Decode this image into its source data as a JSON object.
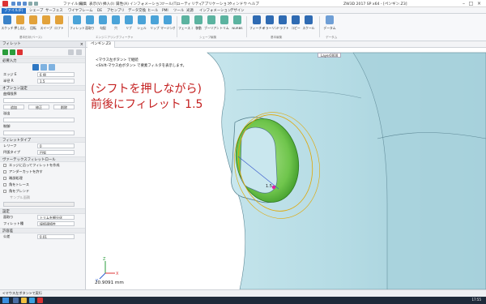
{
  "titlebar": {
    "menus": [
      "ファイル(F)",
      "編集",
      "表示(V)",
      "挿入(I)",
      "属性(A)",
      "インフォメーション",
      "ツール(T)",
      "ユーティリティ",
      "アプリケーション",
      "ウィンドウ",
      "ヘルプ"
    ],
    "title": "ZW3D 2017 SP x64 - [ペンギン.Z3]"
  },
  "tabs": [
    "ファイル(F)",
    "シェープ",
    "サーフェス",
    "ワイヤフレーム",
    "DE",
    "アセンブリ",
    "データ交換",
    "ヒール",
    "PMI",
    "ツール",
    "光源",
    "インフォメーション",
    "デザイン"
  ],
  "ribbon": {
    "buttons": [
      "スケッチ",
      "押し出し",
      "回転",
      "スイープ",
      "ロフト",
      "フィレット",
      "面取り",
      "勾配",
      "穴",
      "リブ",
      "シェル",
      "リップ",
      "マージンボックス",
      "フェース オフセット",
      "移動",
      "ブーリアン",
      "トリム",
      "NURBS",
      "フィーチャーパターン",
      "ミラーリング",
      "ドラフト",
      "コピー",
      "スケール",
      "データム"
    ],
    "group_labels": [
      "基本形状(ベース)",
      "エンジニアリングフィーチャ",
      "シェープ編集",
      "基本編集",
      "データム"
    ]
  },
  "panel": {
    "title": "フィレット",
    "sections": {
      "required": "必要入力",
      "optional": "オプション設定",
      "fillet_type": "フィレットタイプ",
      "vertex": "ヴァーテックスフィレットロール",
      "settings": "設定",
      "precision": "許容差"
    },
    "fields": {
      "edge_label": "エッジ E",
      "edge_value": "6 個",
      "radius_label": "半径 R",
      "radius_value": "1.5",
      "curve_label": "曲線限界",
      "add_label": "追加",
      "modify_label": "修正",
      "delete_label": "削除",
      "overflow_label": "溢出",
      "control_label": "制御",
      "setback_label": "レリーフ",
      "setback_value": "0",
      "shape_label": "円弧タイプ",
      "shape_value": "円弧",
      "trim_label": "面取り",
      "trim_value": "トリムを細分化",
      "fillet_face_label": "フィレット種",
      "fillet_face_value": "接続連続性",
      "tolerance_label": "公差",
      "tolerance_value": "0.01"
    },
    "checkboxes": [
      "エッジに沿ってフィレットを作成",
      "アンダーカットを許す",
      "端部処理",
      "角をトレース",
      "角をブレンド"
    ],
    "sub_label": "サンプル面積"
  },
  "viewport": {
    "doc_tab": "ペンギン.Z3",
    "hint1": "<マウス左ボタン> で継続",
    "hint2": "<Shift-マウス右ボタン> で要素フィルタを表示します。",
    "layer": "Layer0000",
    "annotation_line1": "(シフトを押しながら)",
    "annotation_line2": "前後にフィレット 1.5",
    "measure": "20.9091 mm",
    "dim_label": "1.5"
  },
  "statusbar": {
    "text": "<マウス左ボタン>で実行"
  },
  "taskbar": {
    "clock": "17:55"
  },
  "colors": {
    "accent": "#2a74c9",
    "model": "#b7dde6",
    "fillet": "#7ccf5a",
    "annotation": "#c42020"
  }
}
